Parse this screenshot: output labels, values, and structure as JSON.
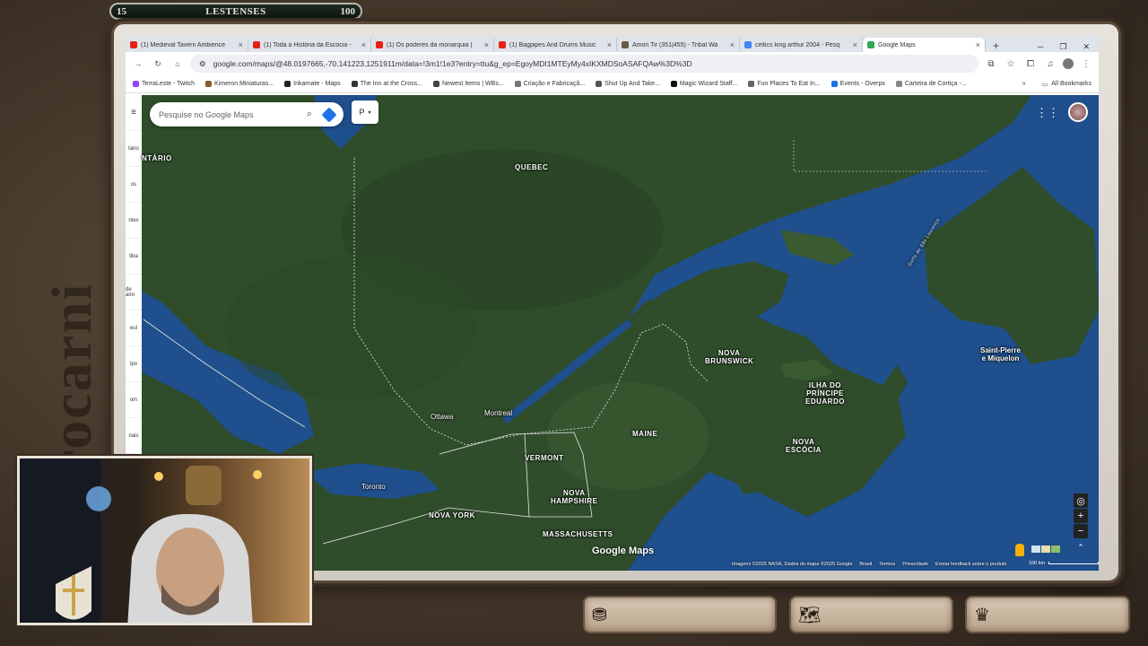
{
  "overlay": {
    "level": "15",
    "username": "LESTENSES",
    "points": "100",
    "side_text": "rocarni"
  },
  "browser": {
    "tabs": [
      {
        "label": "(1) Medieval Tavern Ambience",
        "color": "#e62117"
      },
      {
        "label": "(1) Toda a História da Escócia -",
        "color": "#e62117"
      },
      {
        "label": "(1) Os poderes da monarquia |",
        "color": "#e62117"
      },
      {
        "label": "(1) Bagpipes And Drums Music",
        "color": "#e62117"
      },
      {
        "label": "Amon Tir (351|455) - Tribal Wa",
        "color": "#6b5b45"
      },
      {
        "label": "celtics king arthur 2004 - Pesq",
        "color": "#4285f4"
      },
      {
        "label": "Google Maps",
        "color": "#34a853",
        "active": true
      }
    ],
    "url": "google.com/maps/@48.0197665,-70.141223,1251911m/data=!3m1!1e3?entry=ttu&g_ep=EgoyMDI1MTEyMy4xIKXMDSoASAFQAw%3D%3D",
    "bookmarks": [
      {
        "label": "TerraLeste - Twitch",
        "color": "#9146ff"
      },
      {
        "label": "Kimeron Miniaturas...",
        "color": "#8a5a2b"
      },
      {
        "label": "Inkarnate - Maps",
        "color": "#222"
      },
      {
        "label": "The Inn at the Cross...",
        "color": "#333"
      },
      {
        "label": "Newest Items | WBs...",
        "color": "#444"
      },
      {
        "label": "Criação e Fabricaçã...",
        "color": "#777"
      },
      {
        "label": "Shut Up And Take...",
        "color": "#555"
      },
      {
        "label": "Magic Wizard Staff...",
        "color": "#111"
      },
      {
        "label": "Fun Places To Eat In...",
        "color": "#666"
      },
      {
        "label": "Events - Overpx",
        "color": "#1a73e8"
      },
      {
        "label": "Carteira de Cortiça -...",
        "color": "#888"
      }
    ],
    "all_bookmarks": "All Bookmarks"
  },
  "map": {
    "search_placeholder": "Pesquise no Google Maps",
    "layer_label": "P",
    "rail_items": [
      "tário",
      "os",
      "ntes",
      "tiba",
      "de\nairo",
      "eul",
      "ipo",
      "om",
      "nais"
    ],
    "regions": {
      "ontario": "NTÁRIO",
      "quebec": "QUEBEC",
      "nb1": "NOVA",
      "nb2": "BRUNSWICK",
      "pei1": "ILHA DO",
      "pei2": "PRÍNCIPE",
      "pei3": "EDUARDO",
      "ns1": "NOVA",
      "ns2": "ESCÓCIA",
      "maine": "MAINE",
      "vermont": "VERMONT",
      "nh1": "NOVA",
      "nh2": "HAMPSHIRE",
      "newyork": "NOVA YORK",
      "mass": "MASSACHUSETTS",
      "spm1": "Saint-Pierre",
      "spm2": "e Miquelon",
      "gulf": "Golfo de São Lourenço"
    },
    "cities": {
      "ottawa": "Ottawa",
      "montreal": "Montreal",
      "toronto": "Toronto"
    },
    "brand": "Google Maps",
    "footer": [
      "Imagens ©2025 NASA, Dados do mapa ©2025 Google",
      "Brasil",
      "Termos",
      "Privacidade",
      "Enviar feedback sobre o produto"
    ],
    "scale": "100 km"
  },
  "colors": {
    "land": "#2f4d2b",
    "land_dark": "#243e22",
    "water": "#1f4f8c",
    "border": "#e8e8e8"
  }
}
